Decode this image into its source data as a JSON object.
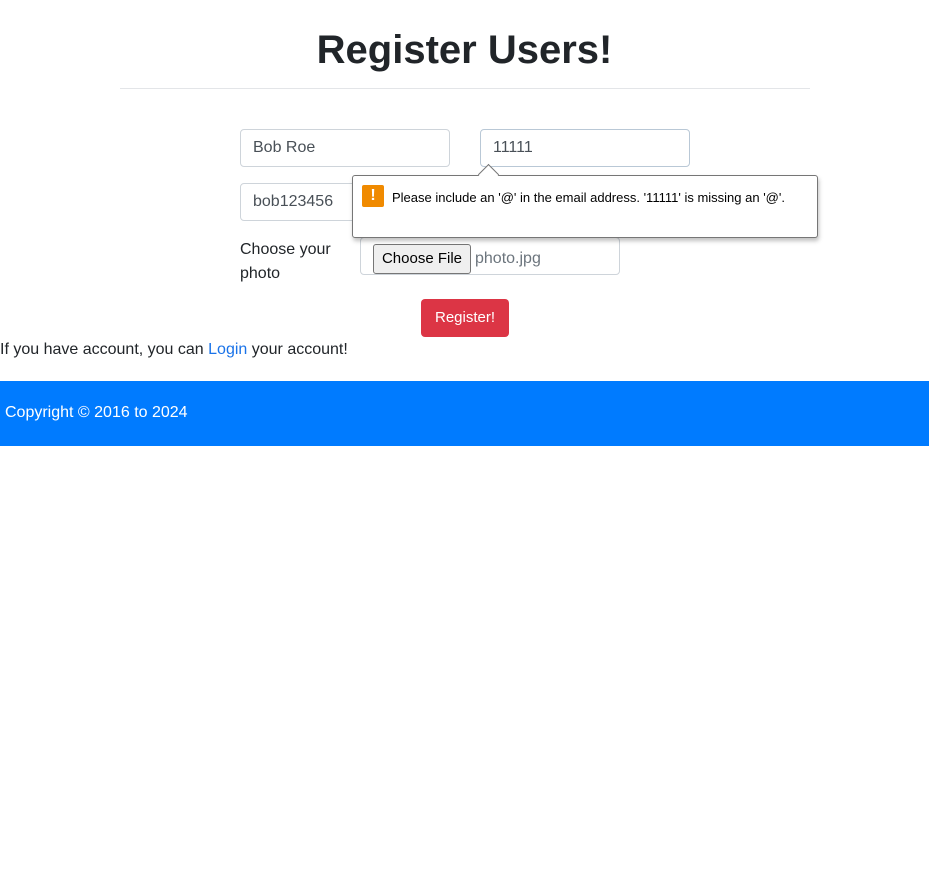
{
  "header": {
    "title": "Register Users!"
  },
  "form": {
    "name_value": "Bob Roe",
    "email_value": "11111",
    "username_value": "bob123456",
    "photo_label": "Choose your photo",
    "file_button_label": "Choose File",
    "file_name": "photo.jpg",
    "register_label": "Register!"
  },
  "validation": {
    "icon": "warning-icon",
    "message": "Please include an '@' in the email address. '11111' is missing an '@'."
  },
  "account": {
    "prefix": "If you have account, you can ",
    "link_label": "Login",
    "suffix": " your account!"
  },
  "footer": {
    "copyright": "Copyright © 2016 to 2024"
  },
  "colors": {
    "register_button": "#dc3545",
    "footer_background": "#007bff",
    "link": "#1a73e8",
    "warning": "#f08a00"
  }
}
